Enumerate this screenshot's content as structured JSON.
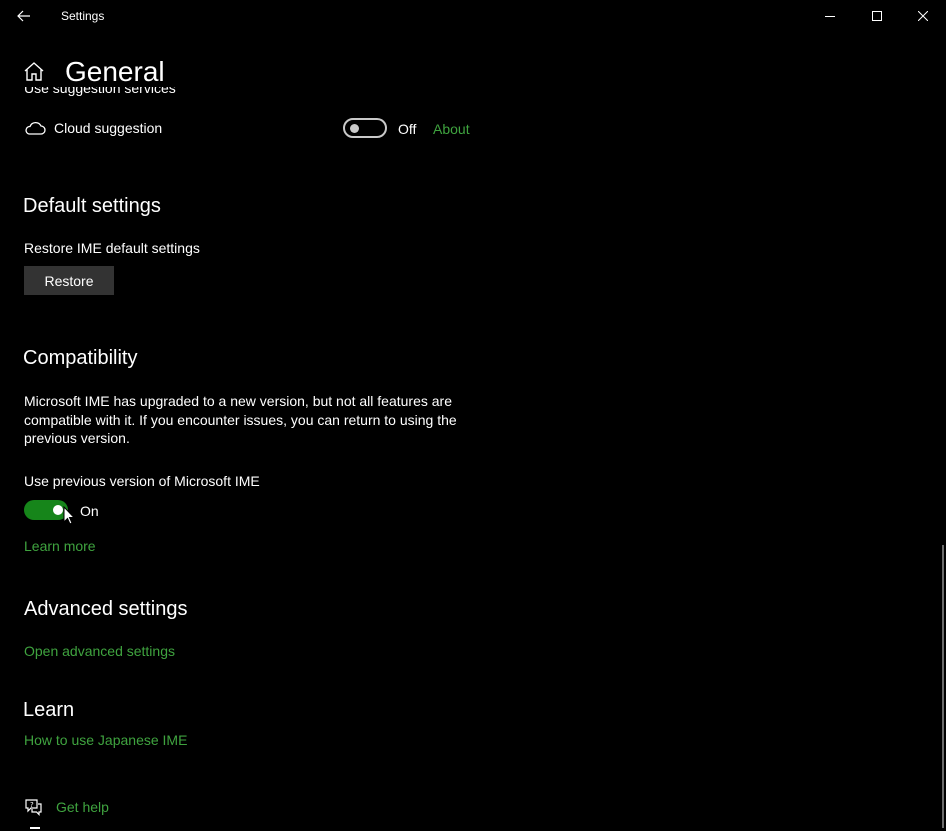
{
  "window": {
    "title": "Settings",
    "back_icon": "back-arrow-icon",
    "minimize_icon": "minimize-icon",
    "maximize_icon": "maximize-icon",
    "close_icon": "close-icon"
  },
  "header": {
    "home_icon": "home-icon",
    "title": "General"
  },
  "suggestion": {
    "clipped_heading": "Use suggestion services",
    "cloud_icon": "cloud-icon",
    "cloud_label": "Cloud suggestion",
    "toggle_state": "Off",
    "about_link": "About"
  },
  "default_settings": {
    "heading": "Default settings",
    "restore_label": "Restore IME default settings",
    "restore_button": "Restore"
  },
  "compatibility": {
    "heading": "Compatibility",
    "description": "Microsoft IME has upgraded to a new version, but not all features are compatible with it. If you encounter issues, you can return to using the previous version.",
    "toggle_label": "Use previous version of Microsoft IME",
    "toggle_state": "On",
    "learn_more": "Learn more"
  },
  "advanced": {
    "heading": "Advanced settings",
    "link": "Open advanced settings"
  },
  "learn": {
    "heading": "Learn",
    "link": "How to use Japanese IME"
  },
  "footer": {
    "help_icon": "get-help-icon",
    "help_link": "Get help"
  },
  "colors": {
    "background": "#000000",
    "accent": "#3fa33f",
    "toggle_on": "#16851a",
    "button_bg": "#333333"
  }
}
